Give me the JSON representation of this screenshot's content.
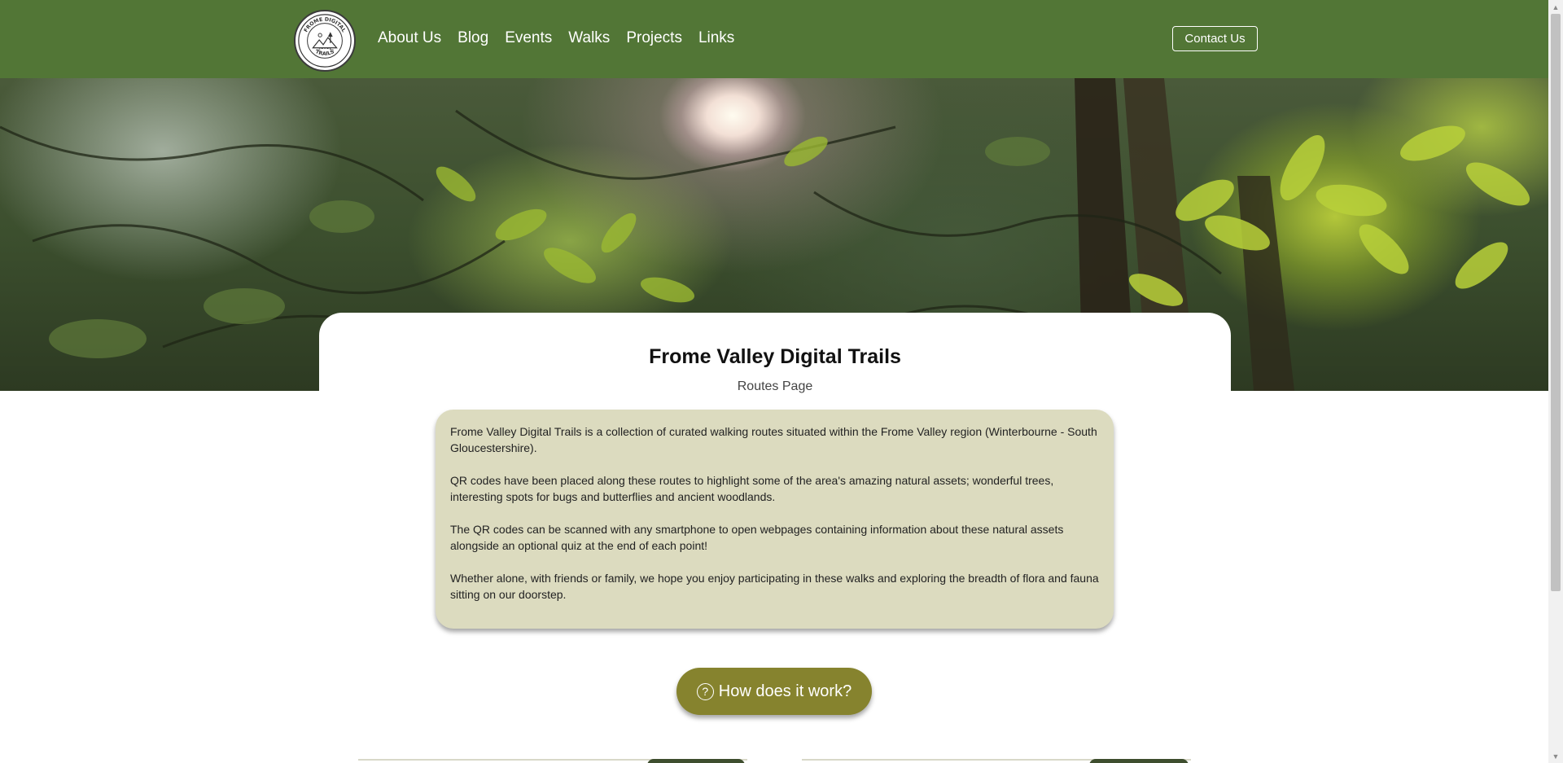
{
  "navbar": {
    "logo_alt": "Frome Digital Trails",
    "logo_text_top": "FROME DIGITAL",
    "logo_text_bottom": "TRAILS",
    "links": [
      {
        "label": "About Us"
      },
      {
        "label": "Blog"
      },
      {
        "label": "Events"
      },
      {
        "label": "Walks"
      },
      {
        "label": "Projects"
      },
      {
        "label": "Links"
      }
    ],
    "contact_label": "Contact Us"
  },
  "hero": {
    "image_icon": "forest-canopy-photo"
  },
  "title_card": {
    "title": "Frome Valley Digital Trails",
    "subtitle": "Routes Page"
  },
  "intro": {
    "paragraphs": [
      "Frome Valley Digital Trails is a collection of curated walking routes situated within the Frome Valley region (Winterbourne - South Gloucestershire).",
      "QR codes have been placed along these routes to highlight some of the area's amazing natural assets; wonderful trees, interesting spots for bugs and butterflies and ancient woodlands.",
      "The QR codes can be scanned with any smartphone to open webpages containing information about these natural assets alongside an optional quiz at the end of each point!",
      "Whether alone, with friends or family, we hope you enjoy participating in these walks and exploring the breadth of flora and fauna sitting on our doorstep."
    ]
  },
  "how_button": {
    "label": "How does it work?",
    "icon": "question-circle-icon"
  },
  "colors": {
    "navbar": "#527636",
    "intro_bg": "#dcdbbf",
    "button": "#86832e"
  }
}
